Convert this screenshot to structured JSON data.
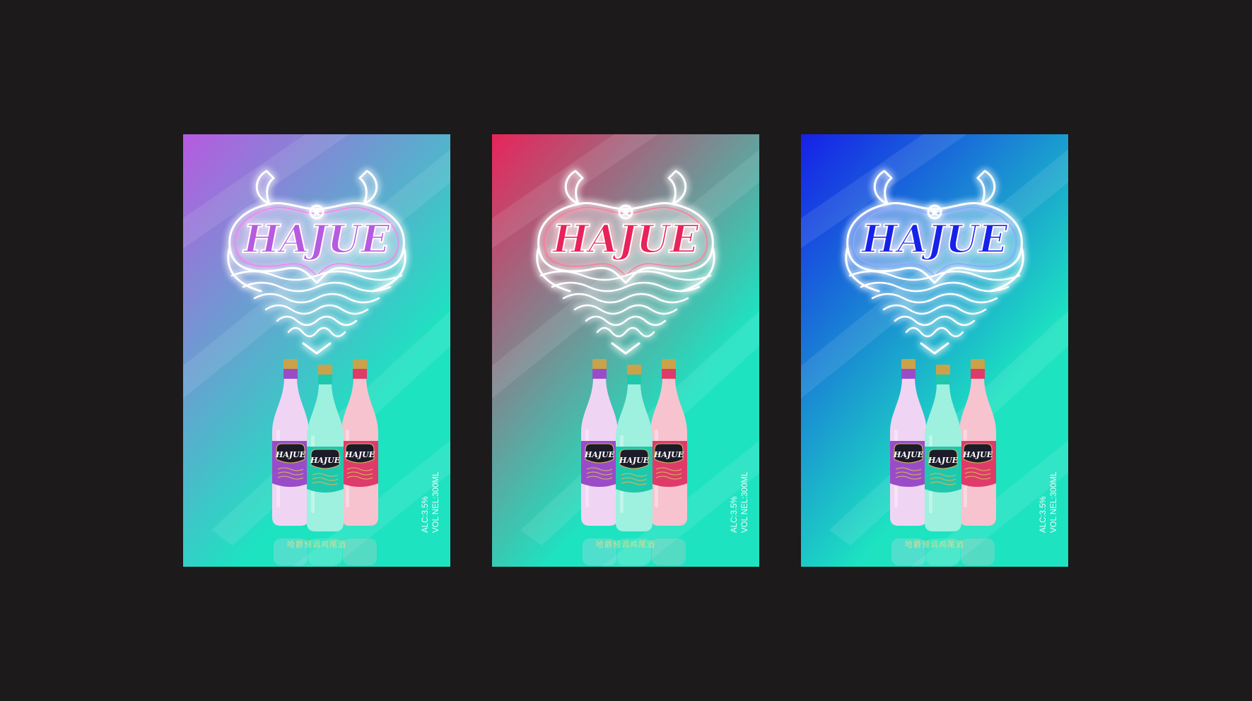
{
  "page": {
    "background": "#1c1a1b"
  },
  "posters": [
    {
      "theme": "purple",
      "gradient_start": "#b65ae0",
      "gradient_end": "#1de3c1",
      "glow": "#ff7ef0",
      "brand": "HAJUE",
      "alc": "ALC:3.5%",
      "volume": "VOL NEL:300ML",
      "tagline": "哈爵预调鸡尾酒",
      "bottles": [
        {
          "name": "HAJUE",
          "bottle_color": "#f0d4f4",
          "label_color": "#9a4cc8"
        },
        {
          "name": "HAJUE",
          "bottle_color": "#9ef0df",
          "label_color": "#1ec8ad"
        },
        {
          "name": "HAJUE",
          "bottle_color": "#f7c3cf",
          "label_color": "#de3b6a"
        }
      ]
    },
    {
      "theme": "red",
      "gradient_start": "#e8245a",
      "gradient_end": "#1de3c1",
      "glow": "#ff7a9a",
      "brand": "HAJUE",
      "alc": "ALC:3.5%",
      "volume": "VOL NEL:300ML",
      "tagline": "哈爵预调鸡尾酒",
      "bottles": [
        {
          "name": "HAJUE",
          "bottle_color": "#f0d4f4",
          "label_color": "#9a4cc8"
        },
        {
          "name": "HAJUE",
          "bottle_color": "#9ef0df",
          "label_color": "#1ec8ad"
        },
        {
          "name": "HAJUE",
          "bottle_color": "#f7c3cf",
          "label_color": "#de3b6a"
        }
      ]
    },
    {
      "theme": "blue",
      "gradient_start": "#1620e8",
      "gradient_end": "#1de3c1",
      "glow": "#8aa8ff",
      "brand": "HAJUE",
      "alc": "ALC:3.5%",
      "volume": "VOL NEL:300ML",
      "tagline": "哈爵预调鸡尾酒",
      "bottles": [
        {
          "name": "HAJUE",
          "bottle_color": "#f0d4f4",
          "label_color": "#9a4cc8"
        },
        {
          "name": "HAJUE",
          "bottle_color": "#9ef0df",
          "label_color": "#1ec8ad"
        },
        {
          "name": "HAJUE",
          "bottle_color": "#f7c3cf",
          "label_color": "#de3b6a"
        }
      ]
    }
  ]
}
